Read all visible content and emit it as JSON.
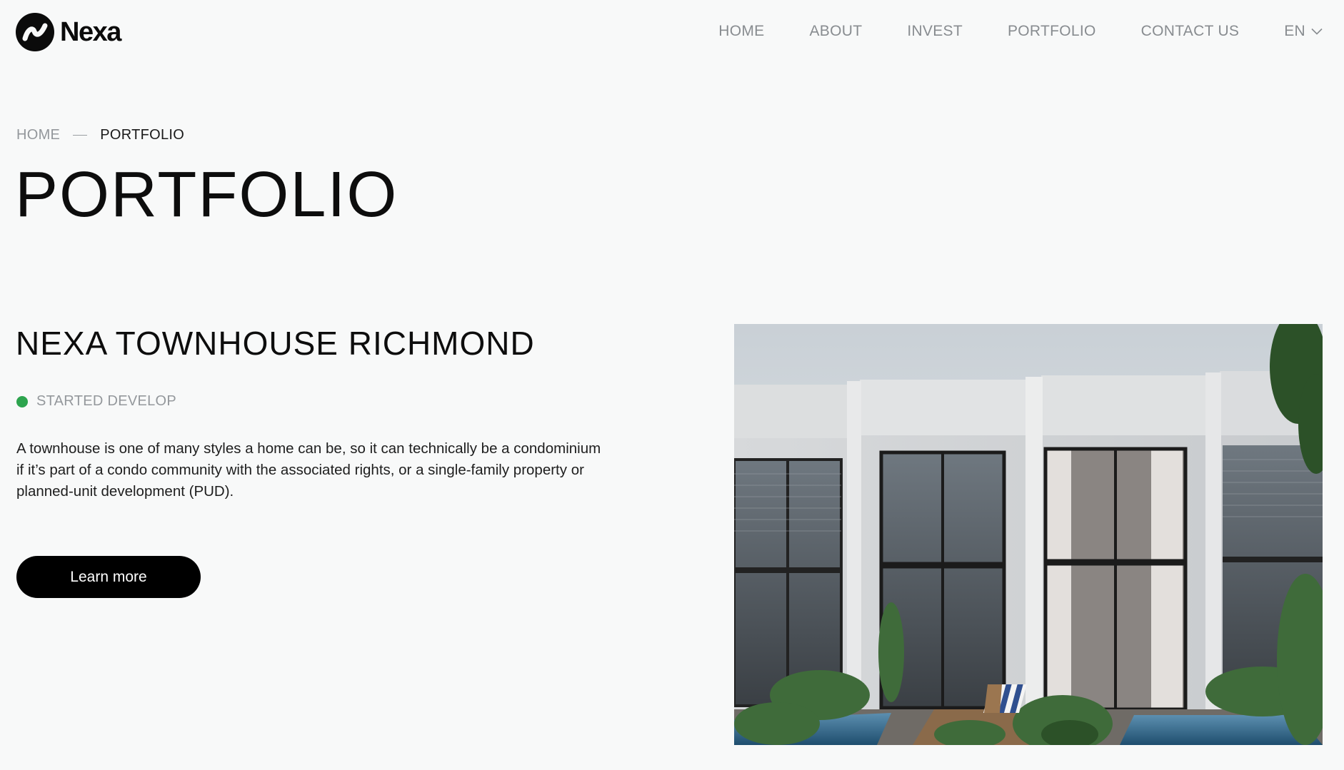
{
  "brand": {
    "name": "Nexa"
  },
  "nav": {
    "items": [
      "HOME",
      "ABOUT",
      "INVEST",
      "PORTFOLIO",
      "CONTACT US"
    ],
    "language": "EN"
  },
  "breadcrumb": {
    "home": "HOME",
    "current": "PORTFOLIO"
  },
  "page": {
    "title": "PORTFOLIO"
  },
  "project": {
    "title": "NEXA TOWNHOUSE RICHMOND",
    "status": "STARTED DEVELOP",
    "status_color": "#2da44e",
    "description": "A townhouse is one of many styles a home can be, so it can technically be a condominium if it’s part of a condo community with the associated rights, or a single-family property or planned-unit development (PUD).",
    "cta": "Learn more"
  },
  "colors": {
    "background": "#f8f9f9",
    "nav_text": "#888c90",
    "button_bg": "#000000",
    "button_text": "#ffffff"
  }
}
